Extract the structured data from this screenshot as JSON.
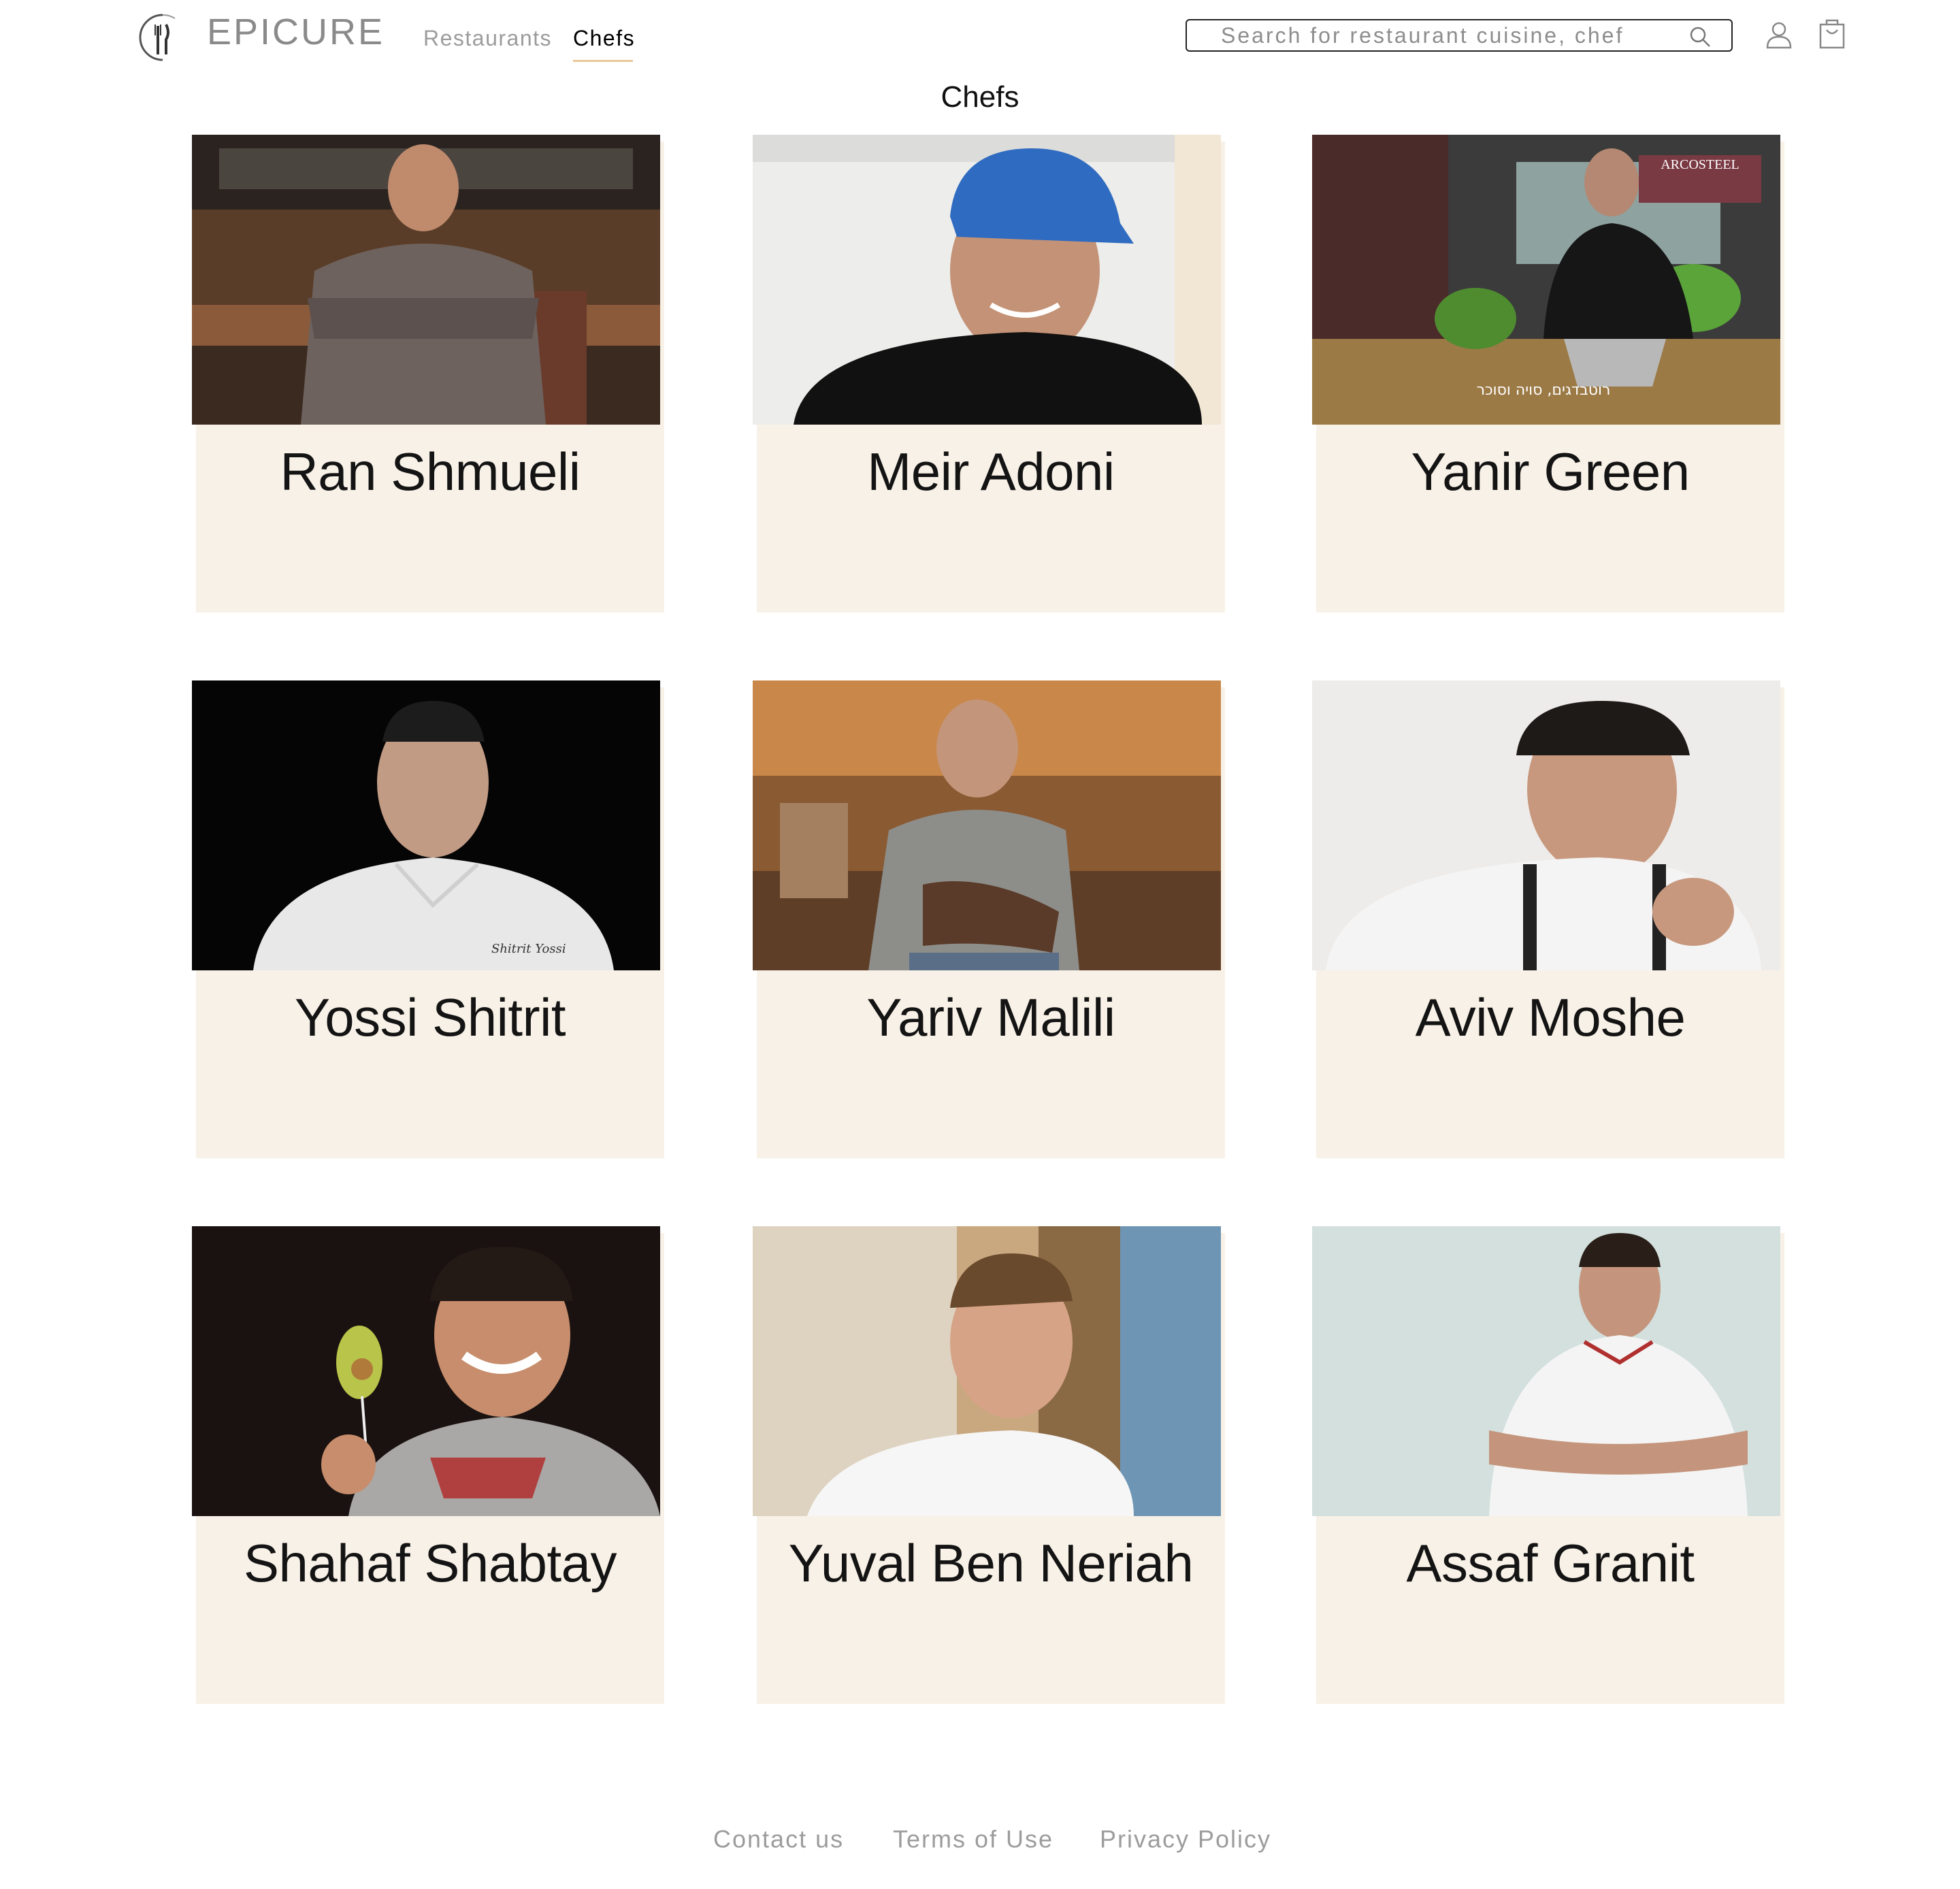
{
  "header": {
    "brand": "EPICURE",
    "nav": [
      {
        "label": "Restaurants",
        "active": false
      },
      {
        "label": "Chefs",
        "active": true
      }
    ],
    "search_placeholder": "Search for restaurant cuisine, chef",
    "accent_color": "#e8c89a"
  },
  "page_title": "Chefs",
  "chefs": [
    {
      "name": "Ran Shmueli"
    },
    {
      "name": "Meir Adoni"
    },
    {
      "name": "Yanir Green",
      "photo_caption": "רוטבדגים, סויה וסוכר",
      "photo_brand": "ARCOSTEEL"
    },
    {
      "name": "Yossi Shitrit",
      "photo_text": "Shitrit Yossi"
    },
    {
      "name": "Yariv Malili"
    },
    {
      "name": "Aviv Moshe"
    },
    {
      "name": "Shahaf Shabtay"
    },
    {
      "name": "Yuval Ben Neriah"
    },
    {
      "name": "Assaf Granit"
    }
  ],
  "footer": {
    "links": [
      "Contact us",
      "Terms of Use",
      "Privacy Policy"
    ]
  },
  "colors": {
    "card_background": "#f8f1e7",
    "muted_text": "#9c9c9c"
  }
}
